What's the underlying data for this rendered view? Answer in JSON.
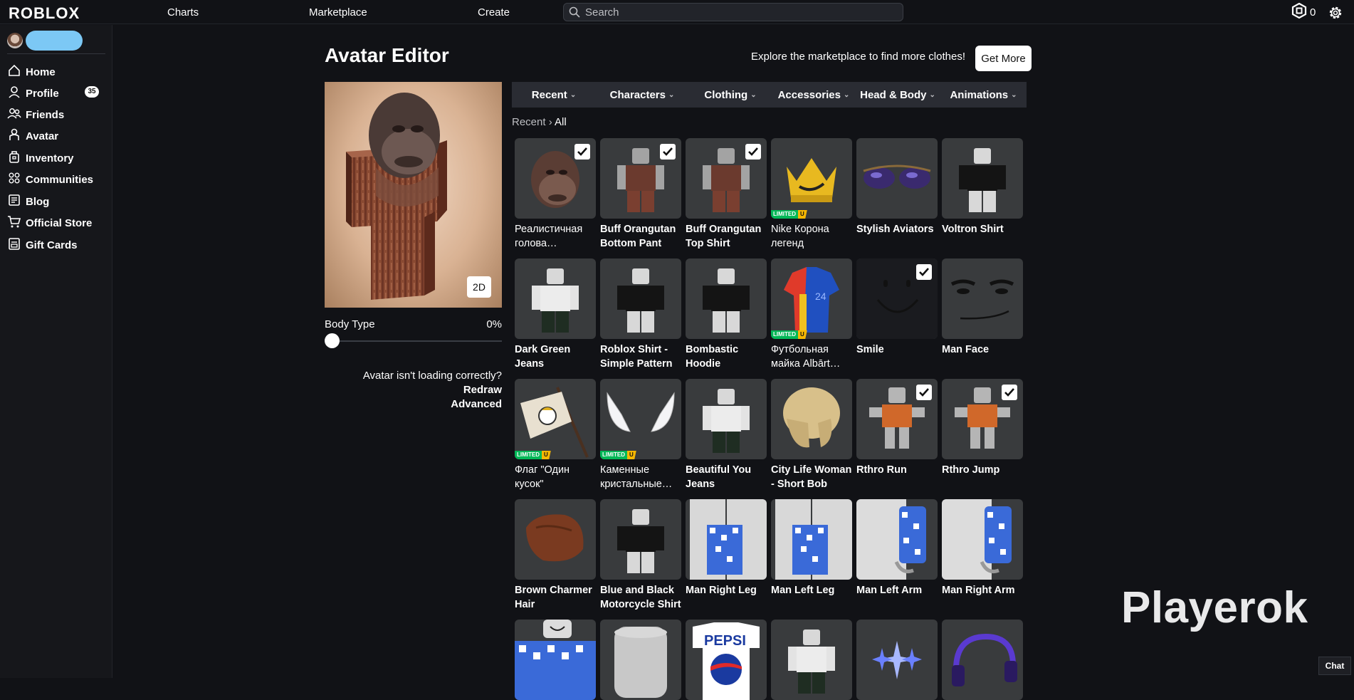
{
  "topbar": {
    "logo": "ROBLOX",
    "nav": [
      "Charts",
      "Marketplace",
      "Create"
    ],
    "search_placeholder": "Search",
    "robux_count": "0"
  },
  "sidebar": {
    "items": [
      {
        "label": "Home",
        "icon": "home-icon"
      },
      {
        "label": "Profile",
        "icon": "profile-icon"
      },
      {
        "label": "Friends",
        "icon": "friends-icon",
        "badge": "35"
      },
      {
        "label": "Avatar",
        "icon": "avatar-icon"
      },
      {
        "label": "Inventory",
        "icon": "inventory-icon"
      },
      {
        "label": "Communities",
        "icon": "communities-icon"
      },
      {
        "label": "Blog",
        "icon": "blog-icon"
      },
      {
        "label": "Official Store",
        "icon": "store-icon"
      },
      {
        "label": "Gift Cards",
        "icon": "gift-card-icon"
      }
    ]
  },
  "main": {
    "title": "Avatar Editor",
    "explore_text": "Explore the marketplace to find more clothes!",
    "get_more": "Get More",
    "view_toggle": "2D",
    "body_type_label": "Body Type",
    "body_type_value": "0%",
    "body_type_fraction": 0,
    "redraw_prompt": "Avatar isn't loading correctly?",
    "redraw_link": "Redraw",
    "advanced_link": "Advanced"
  },
  "categories": [
    "Recent",
    "Characters",
    "Clothing",
    "Accessories",
    "Head & Body",
    "Animations"
  ],
  "breadcrumb": {
    "parent": "Recent",
    "separator": "›",
    "current": "All"
  },
  "items": [
    {
      "name": "Реалистичная голова…",
      "checked": true,
      "limited": false,
      "thumb": "orangutan-head"
    },
    {
      "name": "Buff Orangutan Bottom Pant",
      "checked": true,
      "limited": false,
      "thumb": "figure-brown"
    },
    {
      "name": "Buff Orangutan Top Shirt",
      "checked": true,
      "limited": false,
      "thumb": "figure-brown"
    },
    {
      "name": "Nike Корона легенд",
      "checked": false,
      "limited": true,
      "thumb": "crown"
    },
    {
      "name": "Stylish Aviators",
      "checked": false,
      "limited": false,
      "thumb": "aviators"
    },
    {
      "name": "Voltron Shirt",
      "checked": false,
      "limited": false,
      "thumb": "figure-black"
    },
    {
      "name": "Dark Green Jeans",
      "checked": false,
      "limited": false,
      "thumb": "figure-white"
    },
    {
      "name": "Roblox Shirt - Simple Pattern",
      "checked": false,
      "limited": false,
      "thumb": "figure-black"
    },
    {
      "name": "Bombastic Hoodie",
      "checked": false,
      "limited": false,
      "thumb": "figure-black"
    },
    {
      "name": "Футбольная майка Albārt…",
      "checked": false,
      "limited": true,
      "thumb": "jersey"
    },
    {
      "name": "Smile",
      "checked": true,
      "limited": false,
      "thumb": "smile"
    },
    {
      "name": "Man Face",
      "checked": false,
      "limited": false,
      "thumb": "man-face"
    },
    {
      "name": "Флаг \"Один кусок\"",
      "checked": false,
      "limited": true,
      "thumb": "flag"
    },
    {
      "name": "Каменные кристальные…",
      "checked": false,
      "limited": true,
      "thumb": "horns"
    },
    {
      "name": "Beautiful You Jeans",
      "checked": false,
      "limited": false,
      "thumb": "figure-white"
    },
    {
      "name": "City Life Woman - Short Bob",
      "checked": false,
      "limited": false,
      "thumb": "hair-blonde"
    },
    {
      "name": "Rthro Run",
      "checked": true,
      "limited": false,
      "thumb": "figure-orange"
    },
    {
      "name": "Rthro Jump",
      "checked": true,
      "limited": false,
      "thumb": "figure-orange"
    },
    {
      "name": "Brown Charmer Hair",
      "checked": false,
      "limited": false,
      "thumb": "hair-brown"
    },
    {
      "name": "Blue and Black Motorcycle Shirt",
      "checked": false,
      "limited": false,
      "thumb": "figure-black"
    },
    {
      "name": "Man Right Leg",
      "checked": false,
      "limited": false,
      "thumb": "leg"
    },
    {
      "name": "Man Left Leg",
      "checked": false,
      "limited": false,
      "thumb": "leg"
    },
    {
      "name": "Man Left Arm",
      "checked": false,
      "limited": false,
      "thumb": "arm"
    },
    {
      "name": "Man Right Arm",
      "checked": false,
      "limited": false,
      "thumb": "arm"
    },
    {
      "name": "",
      "checked": false,
      "limited": false,
      "thumb": "torso-check"
    },
    {
      "name": "",
      "checked": false,
      "limited": false,
      "thumb": "head-plain"
    },
    {
      "name": "",
      "checked": false,
      "limited": false,
      "thumb": "pepsi"
    },
    {
      "name": "",
      "checked": false,
      "limited": false,
      "thumb": "figure-white"
    },
    {
      "name": "",
      "checked": false,
      "limited": false,
      "thumb": "sparkle"
    },
    {
      "name": "",
      "checked": false,
      "limited": false,
      "thumb": "headphones"
    }
  ],
  "limited_label": "LIMITED",
  "limited_u": "U",
  "watermark": "Playerok",
  "chat": "Chat",
  "colors": {
    "bg": "#111216",
    "sidebar": "#16171b",
    "tile": "#393b3d",
    "limited_green": "#02b757",
    "limited_gold": "#f6b702"
  }
}
